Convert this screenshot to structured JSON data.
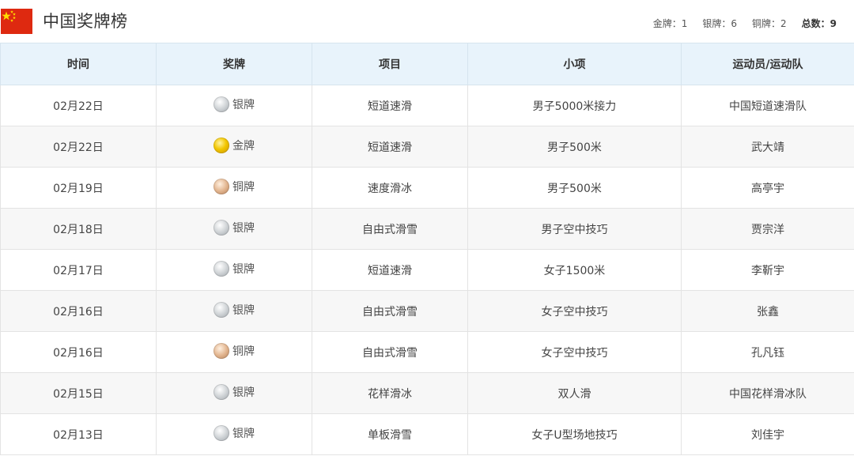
{
  "header": {
    "title": "中国奖牌榜",
    "summary": {
      "gold_label": "金牌：1",
      "silver_label": "银牌：6",
      "bronze_label": "铜牌：2",
      "total_prefix": "总数：",
      "total_value": "9"
    }
  },
  "table": {
    "columns": [
      "时间",
      "奖牌",
      "项目",
      "小项",
      "运动员/运动队"
    ],
    "rows": [
      {
        "date": "02月22日",
        "medal": "银牌",
        "medal_type": "silver",
        "sport": "短道速滑",
        "event": "男子5000米接力",
        "athlete": "中国短道速滑队"
      },
      {
        "date": "02月22日",
        "medal": "金牌",
        "medal_type": "gold",
        "sport": "短道速滑",
        "event": "男子500米",
        "athlete": "武大靖"
      },
      {
        "date": "02月19日",
        "medal": "铜牌",
        "medal_type": "bronze",
        "sport": "速度滑冰",
        "event": "男子500米",
        "athlete": "高亭宇"
      },
      {
        "date": "02月18日",
        "medal": "银牌",
        "medal_type": "silver",
        "sport": "自由式滑雪",
        "event": "男子空中技巧",
        "athlete": "贾宗洋"
      },
      {
        "date": "02月17日",
        "medal": "银牌",
        "medal_type": "silver",
        "sport": "短道速滑",
        "event": "女子1500米",
        "athlete": "李靳宇"
      },
      {
        "date": "02月16日",
        "medal": "银牌",
        "medal_type": "silver",
        "sport": "自由式滑雪",
        "event": "女子空中技巧",
        "athlete": "张鑫"
      },
      {
        "date": "02月16日",
        "medal": "铜牌",
        "medal_type": "bronze",
        "sport": "自由式滑雪",
        "event": "女子空中技巧",
        "athlete": "孔凡钰"
      },
      {
        "date": "02月15日",
        "medal": "银牌",
        "medal_type": "silver",
        "sport": "花样滑冰",
        "event": "双人滑",
        "athlete": "中国花样滑冰队"
      },
      {
        "date": "02月13日",
        "medal": "银牌",
        "medal_type": "silver",
        "sport": "单板滑雪",
        "event": "女子U型场地技巧",
        "athlete": "刘佳宇"
      }
    ]
  },
  "colors": {
    "header_bg": "#e8f3fb",
    "alt_row_bg": "#f7f7f7",
    "flag_red": "#de2910",
    "flag_yellow": "#ffde00"
  }
}
